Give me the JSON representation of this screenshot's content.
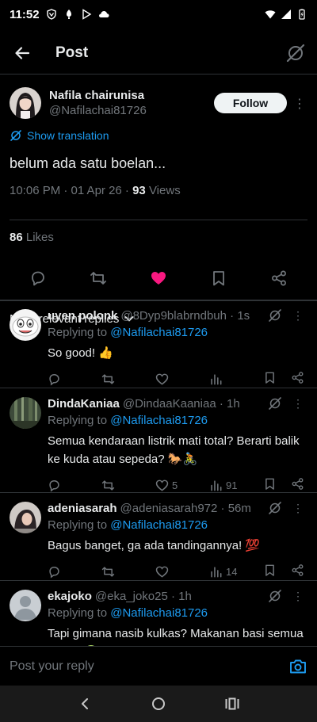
{
  "status": {
    "time": "11:52"
  },
  "header": {
    "title": "Post"
  },
  "post": {
    "author_name": "Nafila chairunisa",
    "author_handle": "@Nafilachai81726",
    "follow_label": "Follow",
    "translate_label": "Show translation",
    "text": "belum ada satu boelan...",
    "timestamp": "10:06 PM · 01 Apr 26 · ",
    "views_count": "93",
    "views_label": " Views",
    "likes_count": "86",
    "likes_label": " Likes",
    "liked": true
  },
  "sort": {
    "label": "Most relevant replies"
  },
  "replies": [
    {
      "name": "uyen polonk",
      "handle": "@8Dyp9blabrndbuh · 1s",
      "replying_prefix": "Replying to ",
      "replying_to": "@Nafilachai81726",
      "text": "So good! 👍",
      "likes": "",
      "views": ""
    },
    {
      "name": "DindaKaniaa",
      "handle": "@DindaaKaaniaa · 1h",
      "replying_prefix": "Replying to ",
      "replying_to": "@Nafilachai81726",
      "text": "Semua kendaraan listrik mati total? Berarti balik ke kuda atau sepeda? 🐎🚴",
      "likes": "5",
      "views": "91"
    },
    {
      "name": "adeniasarah",
      "handle": "@adeniasarah972 · 56m",
      "replying_prefix": "Replying to ",
      "replying_to": "@Nafilachai81726",
      "text": "Bagus banget, ga ada tandingannya! 💯",
      "likes": "",
      "views": "14"
    },
    {
      "name": "ekajoko",
      "handle": "@eka_joko25 · 1h",
      "replying_prefix": "Replying to ",
      "replying_to": "@Nafilachai81726",
      "text": "Tapi gimana nasib kulkas? Makanan basi semua dong? 🤢",
      "likes": "",
      "views": ""
    }
  ],
  "reply_bar": {
    "placeholder": "Post your reply"
  },
  "colors": {
    "accent": "#1d9bf0",
    "like": "#f91880",
    "muted": "#71767b",
    "divider": "#2f3336"
  }
}
